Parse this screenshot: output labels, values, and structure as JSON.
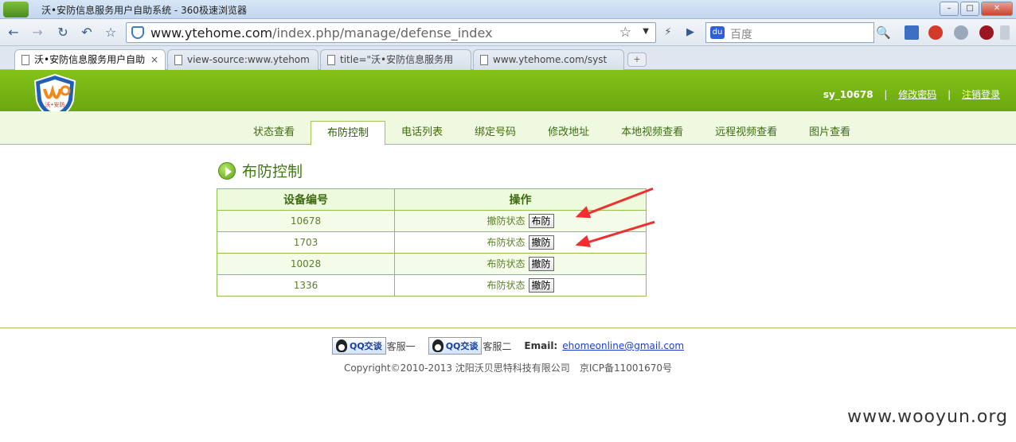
{
  "browser": {
    "window_title": "沃•安防信息服务用户自助系统 - 360极速浏览器",
    "url_host": "www.ytehome.com",
    "url_path": "/index.php/manage/defense_index",
    "search_placeholder": "百度",
    "tabs": [
      {
        "label": "沃•安防信息服务用户自助",
        "active": true
      },
      {
        "label": "view-source:www.ytehom",
        "active": false
      },
      {
        "label": "title=\"沃•安防信息服务用",
        "active": false
      },
      {
        "label": "www.ytehome.com/syst",
        "active": false
      }
    ],
    "tab_close": "×",
    "new_tab": "+",
    "win_min": "–",
    "win_max": "□",
    "win_close": "✕",
    "nav": {
      "back": "←",
      "forward": "→",
      "reload": "↻",
      "undo": "↶",
      "fav": "☆",
      "star": "☆",
      "dropdown": "▼",
      "bolt": "⚡",
      "play": "▶",
      "search": "🔍"
    }
  },
  "header": {
    "logo_text": "沃•安防",
    "username": "sy_10678",
    "change_password": "修改密码",
    "logout": "注销登录",
    "separator": "|"
  },
  "menu": [
    {
      "label": "状态查看",
      "active": false
    },
    {
      "label": "布防控制",
      "active": true
    },
    {
      "label": "电话列表",
      "active": false
    },
    {
      "label": "绑定号码",
      "active": false
    },
    {
      "label": "修改地址",
      "active": false
    },
    {
      "label": "本地视频查看",
      "active": false
    },
    {
      "label": "远程视频查看",
      "active": false
    },
    {
      "label": "图片查看",
      "active": false
    }
  ],
  "section_title": "布防控制",
  "table": {
    "headers": [
      "设备编号",
      "操作"
    ],
    "rows": [
      {
        "device_id": "10678",
        "status": "撤防状态",
        "button": "布防"
      },
      {
        "device_id": "1703",
        "status": "布防状态",
        "button": "撤防"
      },
      {
        "device_id": "10028",
        "status": "布防状态",
        "button": "撤防"
      },
      {
        "device_id": "1336",
        "status": "布防状态",
        "button": "撤防"
      }
    ]
  },
  "footer": {
    "qq_label": "QQ交谈",
    "kf1": "客服一",
    "kf2": "客服二",
    "email_label": "Email:",
    "email": "ehomeonline@gmail.com",
    "copyright": "Copyright©2010-2013 沈阳沃贝思特科技有限公司",
    "icp": "京ICP备11001670号"
  },
  "watermark": "www.wooyun.org",
  "colors": {
    "header_green": "#7ab514",
    "arrow_red": "#f03030",
    "link_blue": "#1a3fcf"
  }
}
